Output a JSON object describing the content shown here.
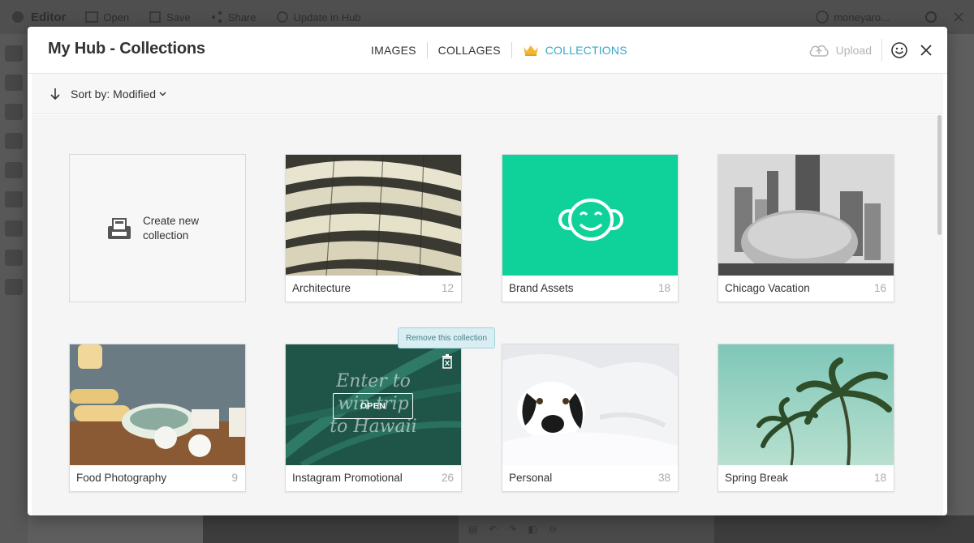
{
  "background": {
    "app_name": "Editor",
    "menu": [
      "Open",
      "Save",
      "Share",
      "Update in Hub"
    ],
    "account": "moneyaro..."
  },
  "modal": {
    "title": "My Hub - Collections",
    "tabs": [
      {
        "label": "IMAGES",
        "active": false
      },
      {
        "label": "COLLAGES",
        "active": false
      },
      {
        "label": "COLLECTIONS",
        "active": true
      }
    ],
    "upload_label": "Upload",
    "sort_label": "Sort by: Modified",
    "create_label_line1": "Create new",
    "create_label_line2": "collection",
    "tooltip": "Remove this collection",
    "open_label": "OPEN",
    "collections": [
      {
        "name": "Architecture",
        "count": "12"
      },
      {
        "name": "Brand Assets",
        "count": "18"
      },
      {
        "name": "Chicago Vacation",
        "count": "16"
      },
      {
        "name": "Food Photography",
        "count": "9"
      },
      {
        "name": "Instagram Promotional",
        "count": "26"
      },
      {
        "name": "Personal",
        "count": "38"
      },
      {
        "name": "Spring Break",
        "count": "18"
      }
    ],
    "promo_text": [
      "Enter to",
      "win trip",
      "to Hawaii"
    ]
  },
  "colors": {
    "accent": "#3aa7c7",
    "brand_green": "#0fd29a",
    "crown": "#f2b631"
  }
}
